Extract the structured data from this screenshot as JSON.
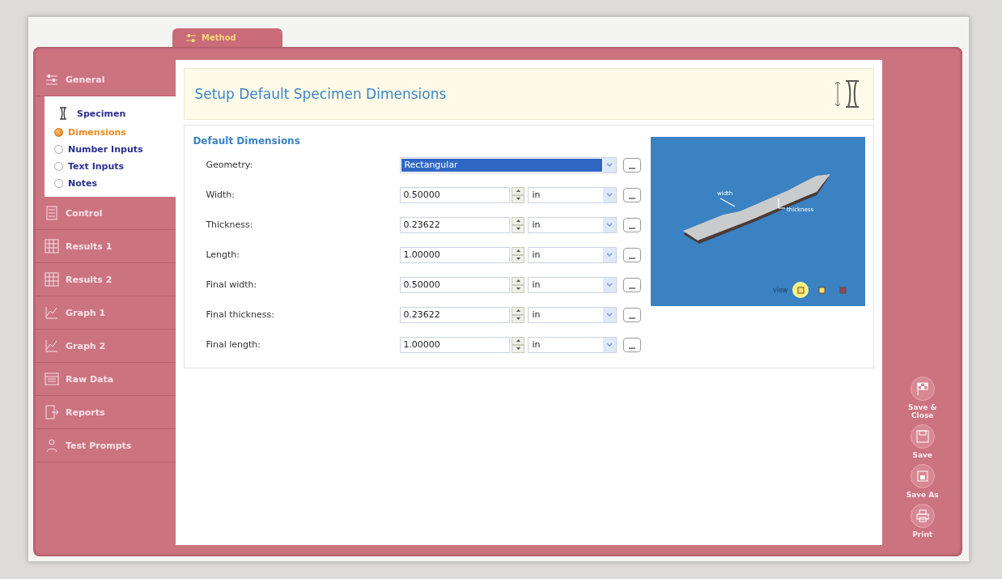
{
  "method_tab": {
    "label": "Method",
    "selected": true
  },
  "sidebar": {
    "items": [
      {
        "label": "General",
        "kind": "general",
        "selected": false
      },
      {
        "label": "Specimen",
        "kind": "specimen",
        "selected": true,
        "children": [
          {
            "label": "Dimensions",
            "selected": true
          },
          {
            "label": "Number Inputs",
            "selected": false
          },
          {
            "label": "Text Inputs",
            "selected": false
          },
          {
            "label": "Notes",
            "selected": false
          }
        ]
      },
      {
        "label": "Control",
        "kind": "control",
        "selected": false
      },
      {
        "label": "Results 1",
        "kind": "table",
        "selected": false
      },
      {
        "label": "Results 2",
        "kind": "table",
        "selected": false
      },
      {
        "label": "Graph 1",
        "kind": "graph",
        "selected": false
      },
      {
        "label": "Graph 2",
        "kind": "graph",
        "selected": false
      },
      {
        "label": "Raw Data",
        "kind": "data",
        "selected": false
      },
      {
        "label": "Reports",
        "kind": "reports",
        "selected": false
      },
      {
        "label": "Test Prompts",
        "kind": "prompts",
        "selected": false
      }
    ]
  },
  "header": {
    "title": "Setup Default Specimen Dimensions"
  },
  "section": {
    "title": "Default Dimensions",
    "fields": [
      {
        "kind": "dropdown",
        "label": "Geometry:",
        "value": "Rectangular"
      },
      {
        "kind": "number",
        "label": "Width:",
        "value": "0.50000",
        "unit": "in"
      },
      {
        "kind": "number",
        "label": "Thickness:",
        "value": "0.23622",
        "unit": "in"
      },
      {
        "kind": "number",
        "label": "Length:",
        "value": "1.00000",
        "unit": "in"
      },
      {
        "kind": "number",
        "label": "Final width:",
        "value": "0.50000",
        "unit": "in"
      },
      {
        "kind": "number",
        "label": "Final thickness:",
        "value": "0.23622",
        "unit": "in"
      },
      {
        "kind": "number",
        "label": "Final length:",
        "value": "1.00000",
        "unit": "in"
      }
    ]
  },
  "preview": {
    "width_label": "width",
    "thickness_label": "thickness",
    "view_label": "view",
    "view_buttons": [
      {
        "selected": true
      },
      {
        "selected": false
      },
      {
        "selected": false
      }
    ]
  },
  "actions": [
    {
      "kind": "save_close",
      "label": "Save & Close"
    },
    {
      "kind": "save",
      "label": "Save"
    },
    {
      "kind": "save_as",
      "label": "Save As"
    },
    {
      "kind": "print",
      "label": "Print"
    }
  ]
}
